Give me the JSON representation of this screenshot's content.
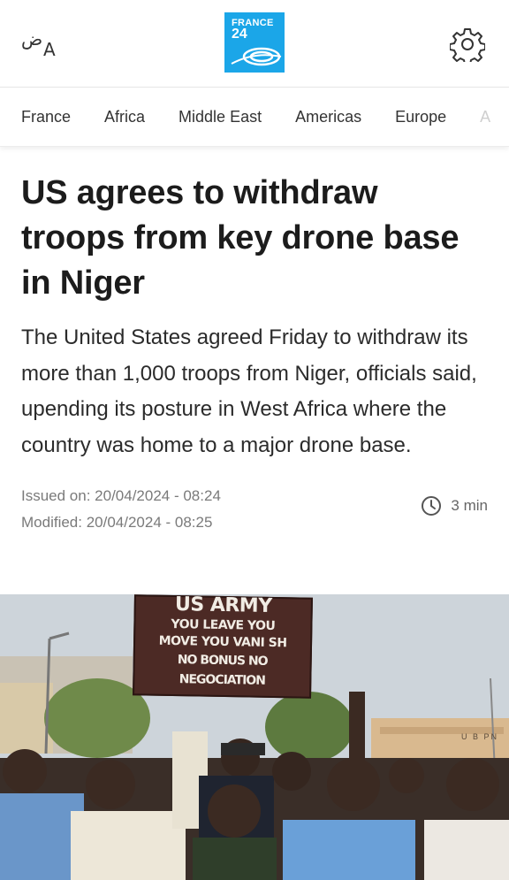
{
  "header": {
    "language_arabic": "ض",
    "language_latin": "A",
    "logo_line1": "FRANCE",
    "logo_line2": "24"
  },
  "nav": {
    "items": [
      "France",
      "Africa",
      "Middle East",
      "Americas",
      "Europe",
      "A"
    ]
  },
  "article": {
    "title": "US agrees to withdraw troops from key drone base in Niger",
    "lead": "The United States agreed Friday to withdraw its more than 1,000 troops from Niger, officials said, upending its posture in West Africa where the country was home to a major drone base.",
    "issued": "Issued on: 20/04/2024 - 08:24",
    "modified": "Modified: 20/04/2024 - 08:25",
    "read_time": "3 min"
  },
  "photo": {
    "sign_line1": "US ARMY",
    "sign_line2": "YOU LEAVE YOU",
    "sign_line3": "MOVE YOU VANI SH",
    "sign_line4": "NO BONUS NO NEGOCIATION",
    "building_text": "U B PN"
  },
  "colors": {
    "brand_blue": "#1ba6e8",
    "title": "#1c1c1c",
    "meta": "#7a7a7a"
  }
}
